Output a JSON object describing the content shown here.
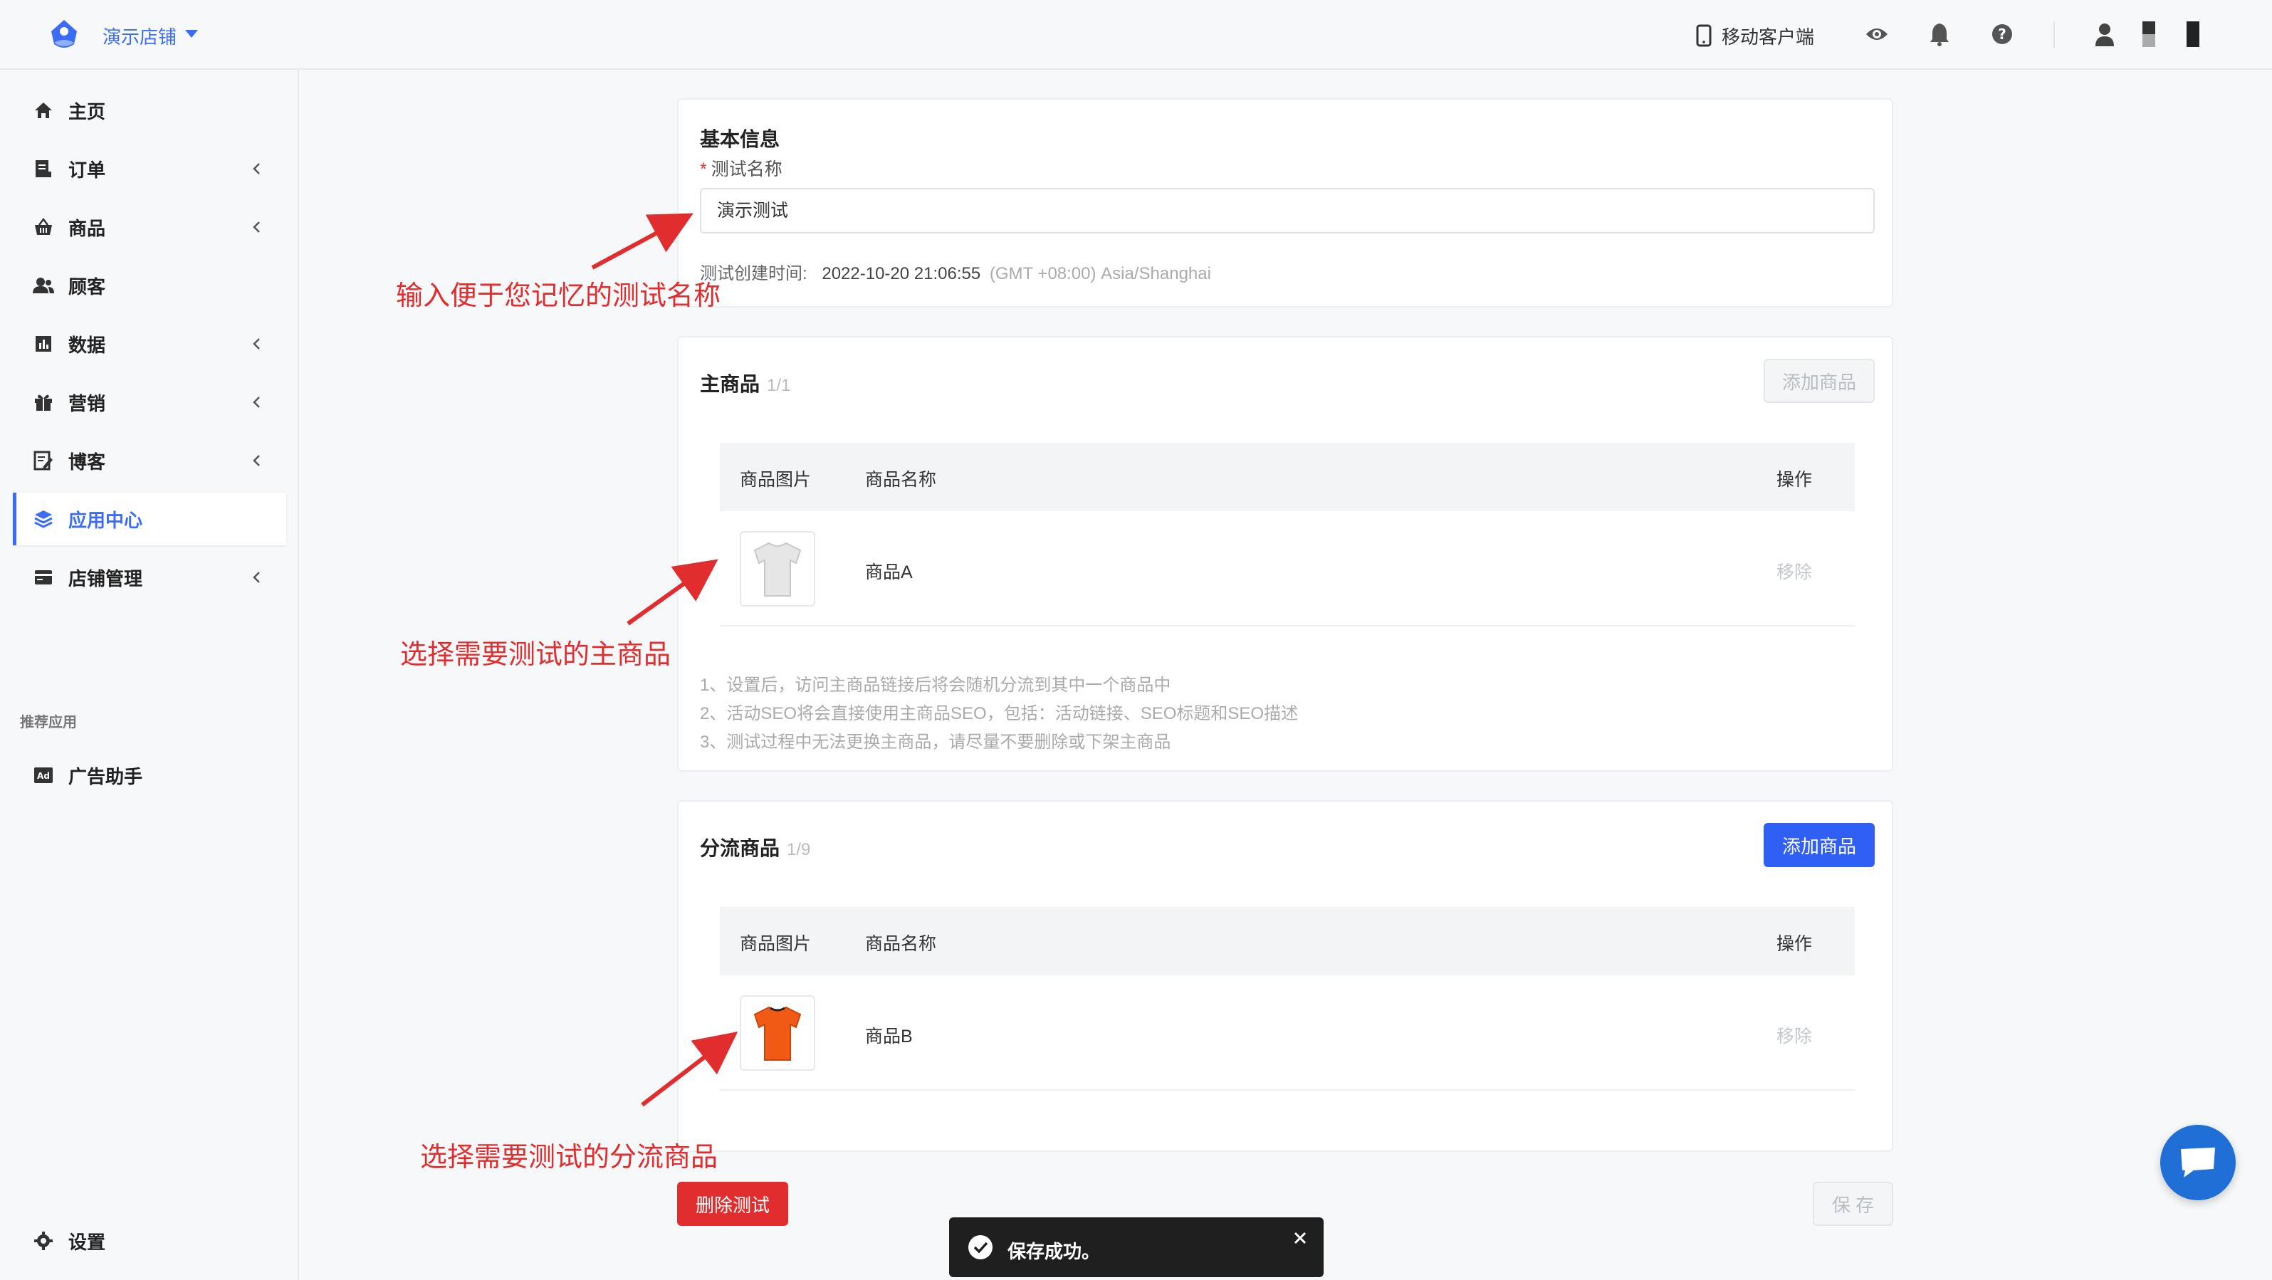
{
  "header": {
    "store_name": "演示店铺",
    "mobile_client": "移动客户端"
  },
  "sidebar": {
    "items": [
      {
        "label": "主页"
      },
      {
        "label": "订单"
      },
      {
        "label": "商品"
      },
      {
        "label": "顾客"
      },
      {
        "label": "数据"
      },
      {
        "label": "营销"
      },
      {
        "label": "博客"
      },
      {
        "label": "应用中心"
      },
      {
        "label": "店铺管理"
      }
    ],
    "recommended_title": "推荐应用",
    "recommended": [
      {
        "label": "广告助手"
      }
    ],
    "settings": "设置",
    "active": "应用中心"
  },
  "basic_info": {
    "title": "基本信息",
    "name_label": "测试名称",
    "name_value": "演示测试",
    "created_label": "测试创建时间:",
    "created_time": "2022-10-20 21:06:55",
    "timezone": "(GMT +08:00) Asia/Shanghai"
  },
  "main_product": {
    "title": "主商品",
    "count": "1/1",
    "add_button": "添加商品",
    "columns": [
      "商品图片",
      "商品名称",
      "操作"
    ],
    "rows": [
      {
        "name": "商品A",
        "action": "移除",
        "image": "white-tshirt"
      }
    ],
    "notes": [
      "1、设置后，访问主商品链接后将会随机分流到其中一个商品中",
      "2、活动SEO将会直接使用主商品SEO，包括：活动链接、SEO标题和SEO描述",
      "3、测试过程中无法更换主商品，请尽量不要删除或下架主商品"
    ]
  },
  "split_product": {
    "title": "分流商品",
    "count": "1/9",
    "add_button": "添加商品",
    "columns": [
      "商品图片",
      "商品名称",
      "操作"
    ],
    "rows": [
      {
        "name": "商品B",
        "action": "移除",
        "image": "orange-tshirt"
      }
    ]
  },
  "footer": {
    "delete_button": "删除测试",
    "save_button": "保 存"
  },
  "toast": {
    "message": "保存成功。"
  },
  "annotations": {
    "a1": "输入便于您记忆的测试名称",
    "a2": "选择需要测试的主商品",
    "a3": "选择需要测试的分流商品"
  },
  "colors": {
    "accent": "#2f5ff5",
    "danger": "#e12d2d",
    "annotation": "#e12d2d"
  }
}
